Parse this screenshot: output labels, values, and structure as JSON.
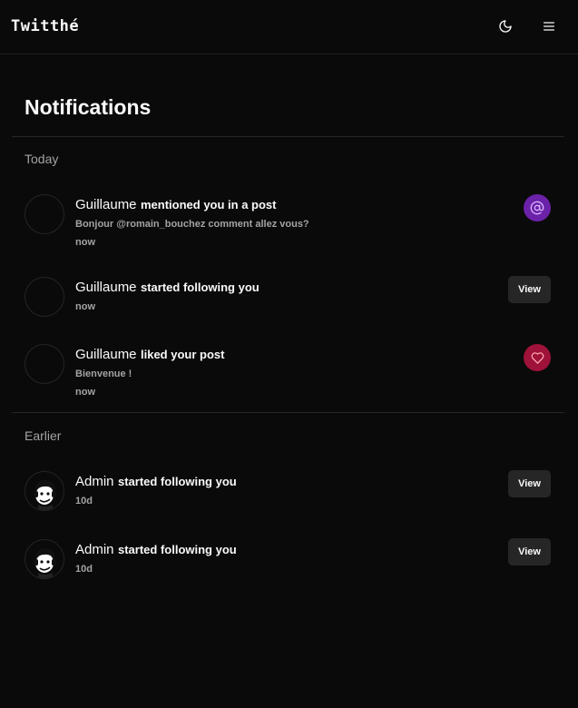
{
  "header": {
    "brand": "Twitthé",
    "theme_icon": "moon-icon",
    "menu_icon": "menu-icon"
  },
  "page": {
    "title": "Notifications"
  },
  "sections": {
    "today": "Today",
    "earlier": "Earlier"
  },
  "notifications": [
    {
      "actor": "Guillaume",
      "action": "mentioned you in a post",
      "preview": "Bonjour @romain_bouchez comment allez vous?",
      "time": "now",
      "indicator": "at-icon"
    },
    {
      "actor": "Guillaume",
      "action": "started following you",
      "time": "now",
      "button": "View"
    },
    {
      "actor": "Guillaume",
      "action": "liked your post",
      "preview": "Bienvenue !",
      "time": "now",
      "indicator": "heart-icon"
    },
    {
      "actor": "Admin",
      "action": "started following you",
      "time": "10d",
      "button": "View"
    },
    {
      "actor": "Admin",
      "action": "started following you",
      "time": "10d",
      "button": "View"
    }
  ],
  "colors": {
    "background": "#0a0a0a",
    "mention_badge": "#6b21a8",
    "like_badge": "#9f1239",
    "button_bg": "#262626",
    "muted_text": "#a3a3a3"
  }
}
